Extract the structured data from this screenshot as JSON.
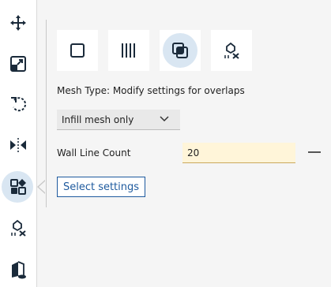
{
  "toolbar": {
    "tools": [
      {
        "name": "move-icon",
        "active": false
      },
      {
        "name": "scale-icon",
        "active": false
      },
      {
        "name": "rotate-icon",
        "active": false
      },
      {
        "name": "mirror-icon",
        "active": false
      },
      {
        "name": "per-model-settings-icon",
        "active": true
      },
      {
        "name": "support-blocker-icon",
        "active": false
      },
      {
        "name": "cube-icon",
        "active": false
      }
    ]
  },
  "mesh_types": [
    {
      "name": "normal-model-icon",
      "selected": false
    },
    {
      "name": "print-as-support-icon",
      "selected": false
    },
    {
      "name": "modify-overlaps-icon",
      "selected": true
    },
    {
      "name": "dont-support-overlaps-icon",
      "selected": false
    }
  ],
  "mesh_type_label": "Mesh Type: Modify settings for overlaps",
  "dropdown": {
    "selected": "Infill mesh only"
  },
  "wall_line_count": {
    "label": "Wall Line Count",
    "value": "20"
  },
  "select_settings_label": "Select settings",
  "colors": {
    "accent": "#1e5a9e",
    "active_bg": "#d9e6f2",
    "input_bg": "#fff5d9"
  }
}
